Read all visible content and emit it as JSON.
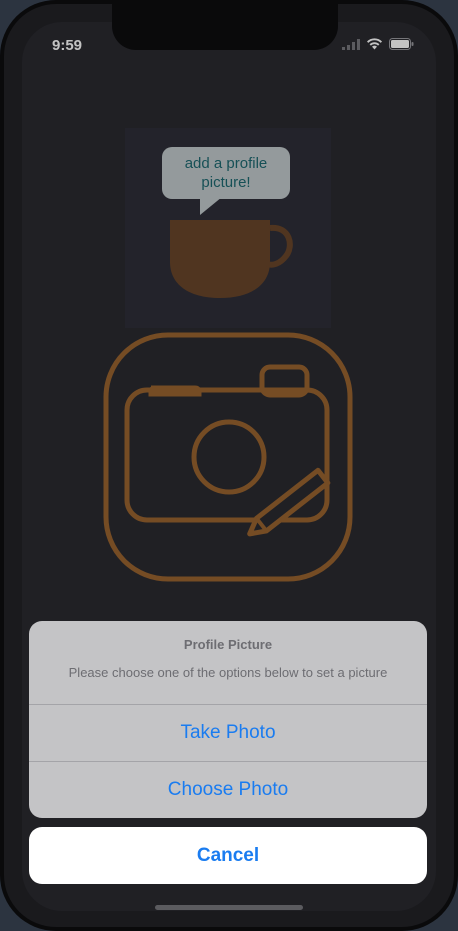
{
  "status_bar": {
    "time": "9:59"
  },
  "profile": {
    "bubble_text_line1": "add a profile",
    "bubble_text_line2": "picture!"
  },
  "action_sheet": {
    "title": "Profile Picture",
    "message": "Please choose one of the options below to set a picture",
    "actions": [
      {
        "label": "Take Photo"
      },
      {
        "label": "Choose Photo"
      }
    ],
    "cancel_label": "Cancel"
  },
  "colors": {
    "accent_blue": "#1a7cf0",
    "camera_brown": "#8a5a2b",
    "cup_brown": "#5e3f26",
    "bubble_bg": "#aeb6b8",
    "bubble_text": "#1b5e66"
  },
  "icons": {
    "signal": "cellular-signal-icon",
    "wifi": "wifi-icon",
    "battery": "battery-icon",
    "camera": "camera-edit-icon",
    "cup": "coffee-cup-icon"
  }
}
